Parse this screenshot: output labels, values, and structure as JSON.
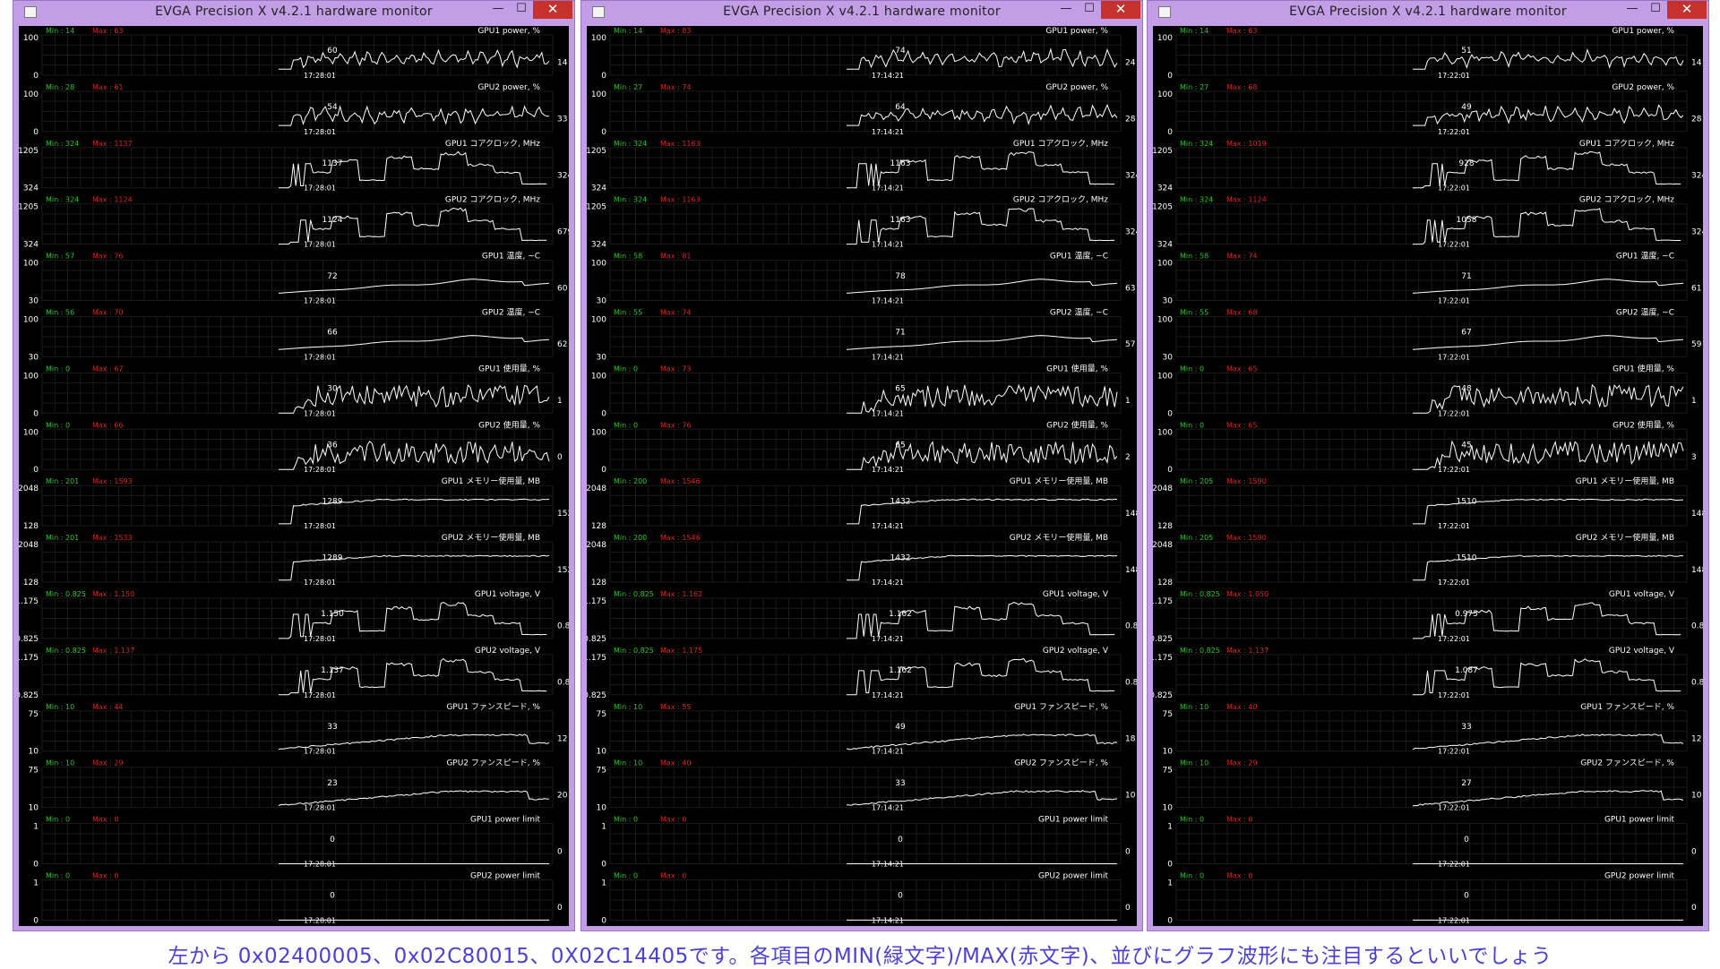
{
  "caption": "左から 0x02400005、0x02C80015、0X02C14405です。各項目のMIN(緑文字)/MAX(赤文字)、並びにグラフ波形にも注目するといいでしょう",
  "colors": {
    "frame": "#c39ee6",
    "min_text": "#2ec52e",
    "max_text": "#e02020",
    "grid": "#1b1b1b",
    "trace": "#ffffff",
    "caption": "#4b3fd8",
    "close_button": "#c6312b"
  },
  "windows": [
    {
      "title": "EVGA Precision X v4.2.1 hardware monitor",
      "icon": "app-icon",
      "buttons": {
        "minimize": "—",
        "maximize": "☐",
        "close": "✕"
      },
      "graphs": [
        {
          "name": "GPU1 power, %",
          "min": "14",
          "max": "63",
          "top": "100",
          "bottom": "0",
          "time": "17:28:01",
          "peak": "60",
          "current": "14",
          "shape": "power"
        },
        {
          "name": "GPU2 power, %",
          "min": "28",
          "max": "61",
          "top": "100",
          "bottom": "0",
          "time": "17:28:01",
          "peak": "54",
          "current": "33",
          "shape": "power"
        },
        {
          "name": "GPU1 コアクロック, MHz",
          "min": "324",
          "max": "1137",
          "top": "1205",
          "bottom": "324",
          "time": "17:28:01",
          "peak": "1137",
          "current": "324",
          "shape": "clock"
        },
        {
          "name": "GPU2 コアクロック, MHz",
          "min": "324",
          "max": "1124",
          "top": "1205",
          "bottom": "324",
          "time": "17:28:01",
          "peak": "1124",
          "current": "679",
          "shape": "clock"
        },
        {
          "name": "GPU1 温度, ~C",
          "min": "57",
          "max": "76",
          "top": "100",
          "bottom": "30",
          "time": "17:28:01",
          "peak": "72",
          "current": "60",
          "shape": "temp"
        },
        {
          "name": "GPU2 温度, ~C",
          "min": "56",
          "max": "70",
          "top": "100",
          "bottom": "30",
          "time": "17:28:01",
          "peak": "66",
          "current": "62",
          "shape": "temp"
        },
        {
          "name": "GPU1 使用量, %",
          "min": "0",
          "max": "67",
          "top": "100",
          "bottom": "0",
          "time": "17:28:01",
          "peak": "30",
          "current": "1",
          "shape": "usage"
        },
        {
          "name": "GPU2 使用量, %",
          "min": "0",
          "max": "66",
          "top": "100",
          "bottom": "0",
          "time": "17:28:01",
          "peak": "36",
          "current": "0",
          "shape": "usage"
        },
        {
          "name": "GPU1 メモリー使用量, MB",
          "min": "201",
          "max": "1593",
          "top": "2048",
          "bottom": "128",
          "time": "17:28:01",
          "peak": "1289",
          "current": "1521",
          "shape": "mem"
        },
        {
          "name": "GPU2 メモリー使用量, MB",
          "min": "201",
          "max": "1533",
          "top": "2048",
          "bottom": "128",
          "time": "17:28:01",
          "peak": "1289",
          "current": "1521",
          "shape": "mem"
        },
        {
          "name": "GPU1 voltage, V",
          "min": "0.825",
          "max": "1.150",
          "top": "1.175",
          "bottom": "0.825",
          "time": "17:28:01",
          "peak": "1.150",
          "current": "0.825",
          "shape": "clock"
        },
        {
          "name": "GPU2 voltage, V",
          "min": "0.825",
          "max": "1.137",
          "top": "1.175",
          "bottom": "0.825",
          "time": "17:28:01",
          "peak": "1.137",
          "current": "0.887",
          "shape": "clock"
        },
        {
          "name": "GPU1 ファンスピード, %",
          "min": "10",
          "max": "44",
          "top": "75",
          "bottom": "10",
          "time": "17:28:01",
          "peak": "33",
          "current": "12",
          "shape": "fan"
        },
        {
          "name": "GPU2 ファンスピード, %",
          "min": "10",
          "max": "29",
          "top": "75",
          "bottom": "10",
          "time": "17:28:01",
          "peak": "23",
          "current": "20",
          "shape": "fan"
        },
        {
          "name": "GPU1 power limit",
          "min": "0",
          "max": "0",
          "top": "1",
          "bottom": "0",
          "time": "17:28:01",
          "peak": "0",
          "current": "0",
          "shape": "flat"
        },
        {
          "name": "GPU2 power limit",
          "min": "0",
          "max": "0",
          "top": "1",
          "bottom": "0",
          "time": "17:28:01",
          "peak": "0",
          "current": "0",
          "shape": "flat"
        }
      ]
    },
    {
      "title": "EVGA Precision X v4.2.1 hardware monitor",
      "icon": "app-icon",
      "buttons": {
        "minimize": "—",
        "maximize": "☐",
        "close": "✕"
      },
      "graphs": [
        {
          "name": "GPU1 power, %",
          "min": "14",
          "max": "83",
          "top": "100",
          "bottom": "0",
          "time": "17:14:21",
          "peak": "74",
          "current": "24",
          "shape": "power"
        },
        {
          "name": "GPU2 power, %",
          "min": "27",
          "max": "74",
          "top": "100",
          "bottom": "0",
          "time": "17:14:21",
          "peak": "64",
          "current": "28",
          "shape": "power"
        },
        {
          "name": "GPU1 コアクロック, MHz",
          "min": "324",
          "max": "1163",
          "top": "1205",
          "bottom": "324",
          "time": "17:14:21",
          "peak": "1163",
          "current": "324",
          "shape": "clock"
        },
        {
          "name": "GPU2 コアクロック, MHz",
          "min": "324",
          "max": "1163",
          "top": "1205",
          "bottom": "324",
          "time": "17:14:21",
          "peak": "1163",
          "current": "324",
          "shape": "clock"
        },
        {
          "name": "GPU1 温度, ~C",
          "min": "58",
          "max": "81",
          "top": "100",
          "bottom": "30",
          "time": "17:14:21",
          "peak": "78",
          "current": "63",
          "shape": "temp"
        },
        {
          "name": "GPU2 温度, ~C",
          "min": "55",
          "max": "74",
          "top": "100",
          "bottom": "30",
          "time": "17:14:21",
          "peak": "71",
          "current": "57",
          "shape": "temp"
        },
        {
          "name": "GPU1 使用量, %",
          "min": "0",
          "max": "73",
          "top": "100",
          "bottom": "0",
          "time": "17:14:21",
          "peak": "65",
          "current": "1",
          "shape": "usage"
        },
        {
          "name": "GPU2 使用量, %",
          "min": "0",
          "max": "76",
          "top": "100",
          "bottom": "0",
          "time": "17:14:21",
          "peak": "65",
          "current": "2",
          "shape": "usage"
        },
        {
          "name": "GPU1 メモリー使用量, MB",
          "min": "200",
          "max": "1546",
          "top": "2048",
          "bottom": "128",
          "time": "17:14:21",
          "peak": "1432",
          "current": "1489",
          "shape": "mem"
        },
        {
          "name": "GPU2 メモリー使用量, MB",
          "min": "200",
          "max": "1546",
          "top": "2048",
          "bottom": "128",
          "time": "17:14:21",
          "peak": "1432",
          "current": "1489",
          "shape": "mem"
        },
        {
          "name": "GPU1 voltage, V",
          "min": "0.825",
          "max": "1.162",
          "top": "1.175",
          "bottom": "0.825",
          "time": "17:14:21",
          "peak": "1.162",
          "current": "0.825",
          "shape": "clock"
        },
        {
          "name": "GPU2 voltage, V",
          "min": "0.825",
          "max": "1.175",
          "top": "1.175",
          "bottom": "0.825",
          "time": "17:14:21",
          "peak": "1.162",
          "current": "0.825",
          "shape": "clock"
        },
        {
          "name": "GPU1 ファンスピード, %",
          "min": "10",
          "max": "55",
          "top": "75",
          "bottom": "10",
          "time": "17:14:21",
          "peak": "49",
          "current": "18",
          "shape": "fan"
        },
        {
          "name": "GPU2 ファンスピード, %",
          "min": "10",
          "max": "40",
          "top": "75",
          "bottom": "10",
          "time": "17:14:21",
          "peak": "33",
          "current": "10",
          "shape": "fan"
        },
        {
          "name": "GPU1 power limit",
          "min": "0",
          "max": "0",
          "top": "1",
          "bottom": "0",
          "time": "17:14:21",
          "peak": "0",
          "current": "0",
          "shape": "flat"
        },
        {
          "name": "GPU2 power limit",
          "min": "0",
          "max": "0",
          "top": "1",
          "bottom": "0",
          "time": "17:14:21",
          "peak": "0",
          "current": "0",
          "shape": "flat"
        }
      ]
    },
    {
      "title": "EVGA Precision X v4.2.1 hardware monitor",
      "icon": "app-icon",
      "buttons": {
        "minimize": "—",
        "maximize": "☐",
        "close": "✕"
      },
      "graphs": [
        {
          "name": "GPU1 power, %",
          "min": "14",
          "max": "63",
          "top": "100",
          "bottom": "0",
          "time": "17:22:01",
          "peak": "51",
          "current": "14",
          "shape": "power"
        },
        {
          "name": "GPU2 power, %",
          "min": "27",
          "max": "68",
          "top": "100",
          "bottom": "0",
          "time": "17:22:01",
          "peak": "49",
          "current": "28",
          "shape": "power"
        },
        {
          "name": "GPU1 コアクロック, MHz",
          "min": "324",
          "max": "1019",
          "top": "1205",
          "bottom": "324",
          "time": "17:22:01",
          "peak": "928",
          "current": "324",
          "shape": "clock"
        },
        {
          "name": "GPU2 コアクロック, MHz",
          "min": "324",
          "max": "1124",
          "top": "1205",
          "bottom": "324",
          "time": "17:22:01",
          "peak": "1058",
          "current": "324",
          "shape": "clock"
        },
        {
          "name": "GPU1 温度, ~C",
          "min": "58",
          "max": "74",
          "top": "100",
          "bottom": "30",
          "time": "17:22:01",
          "peak": "71",
          "current": "61",
          "shape": "temp"
        },
        {
          "name": "GPU2 温度, ~C",
          "min": "55",
          "max": "68",
          "top": "100",
          "bottom": "30",
          "time": "17:22:01",
          "peak": "67",
          "current": "59",
          "shape": "temp"
        },
        {
          "name": "GPU1 使用量, %",
          "min": "0",
          "max": "65",
          "top": "100",
          "bottom": "0",
          "time": "17:22:01",
          "peak": "48",
          "current": "1",
          "shape": "usage"
        },
        {
          "name": "GPU2 使用量, %",
          "min": "0",
          "max": "65",
          "top": "100",
          "bottom": "0",
          "time": "17:22:01",
          "peak": "45",
          "current": "3",
          "shape": "usage"
        },
        {
          "name": "GPU1 メモリー使用量, MB",
          "min": "205",
          "max": "1590",
          "top": "2048",
          "bottom": "128",
          "time": "17:22:01",
          "peak": "1510",
          "current": "1488",
          "shape": "mem"
        },
        {
          "name": "GPU2 メモリー使用量, MB",
          "min": "205",
          "max": "1590",
          "top": "2048",
          "bottom": "128",
          "time": "17:22:01",
          "peak": "1510",
          "current": "1488",
          "shape": "mem"
        },
        {
          "name": "GPU1 voltage, V",
          "min": "0.825",
          "max": "1.050",
          "top": "1.175",
          "bottom": "0.825",
          "time": "17:22:01",
          "peak": "0.975",
          "current": "0.825",
          "shape": "clock"
        },
        {
          "name": "GPU2 voltage, V",
          "min": "0.825",
          "max": "1.137",
          "top": "1.175",
          "bottom": "0.825",
          "time": "17:22:01",
          "peak": "1.087",
          "current": "0.825",
          "shape": "clock"
        },
        {
          "name": "GPU1 ファンスピード, %",
          "min": "10",
          "max": "40",
          "top": "75",
          "bottom": "10",
          "time": "17:22:01",
          "peak": "33",
          "current": "12",
          "shape": "fan"
        },
        {
          "name": "GPU2 ファンスピード, %",
          "min": "10",
          "max": "29",
          "top": "75",
          "bottom": "10",
          "time": "17:22:01",
          "peak": "27",
          "current": "10",
          "shape": "fan"
        },
        {
          "name": "GPU1 power limit",
          "min": "0",
          "max": "0",
          "top": "1",
          "bottom": "0",
          "time": "17:22:01",
          "peak": "0",
          "current": "0",
          "shape": "flat"
        },
        {
          "name": "GPU2 power limit",
          "min": "0",
          "max": "0",
          "top": "1",
          "bottom": "0",
          "time": "17:22:01",
          "peak": "0",
          "current": "0",
          "shape": "flat"
        }
      ]
    }
  ]
}
